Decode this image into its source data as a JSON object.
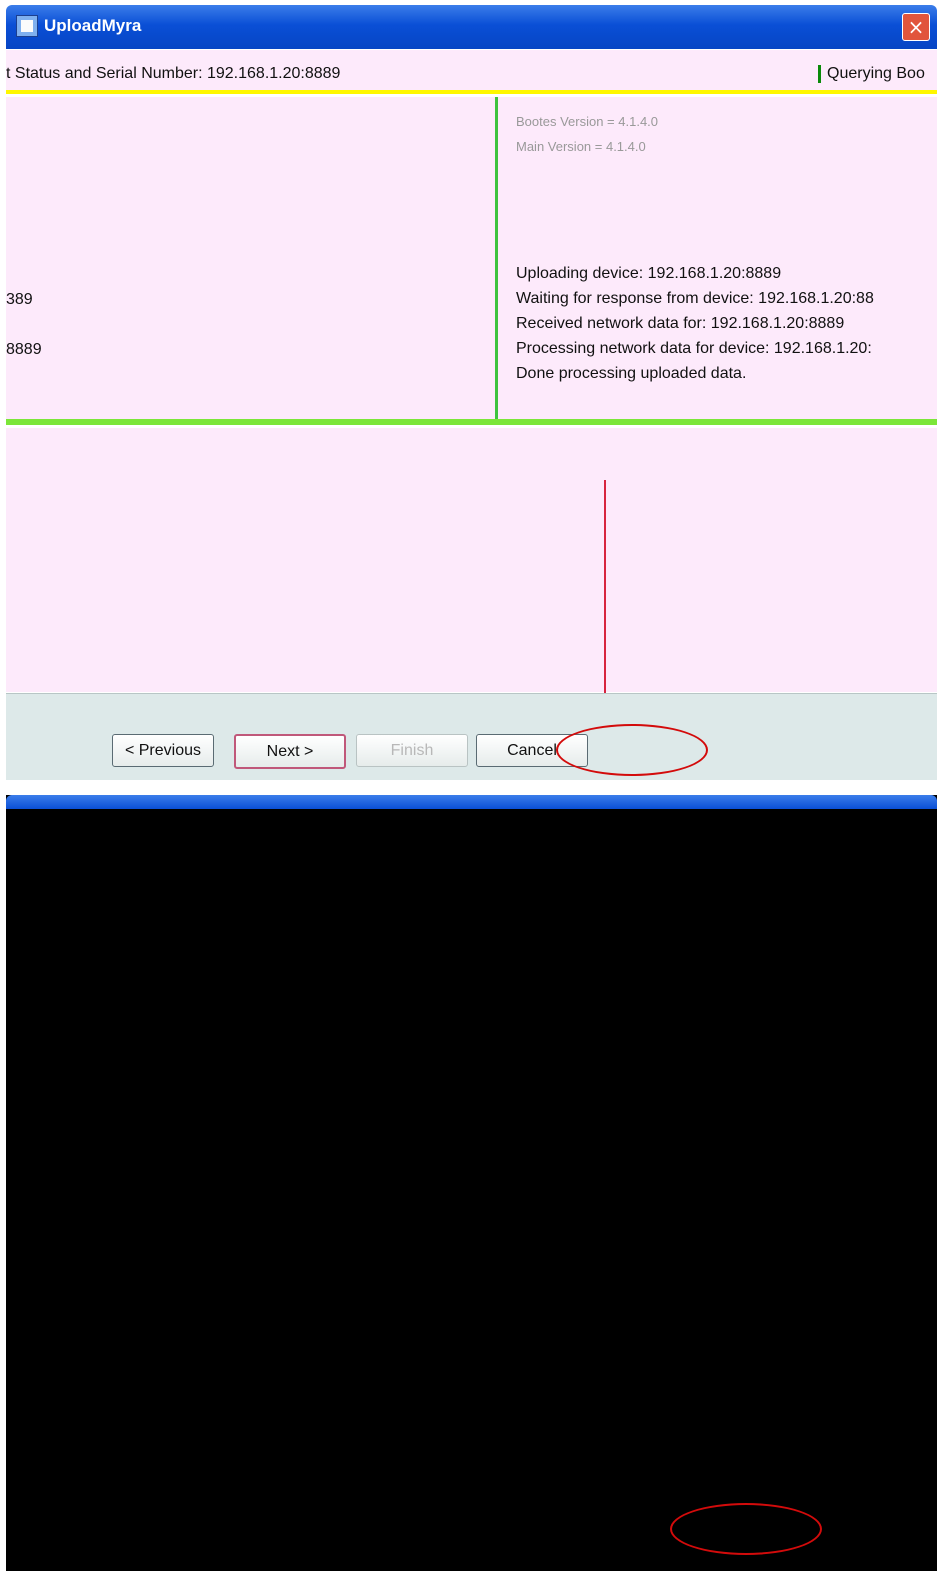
{
  "window": {
    "title": "UploadMyra",
    "close_icon": "close-icon",
    "app_icon": "app-icon"
  },
  "status_row": {
    "label": "t Status and Serial Number: 192.168.1.20:8889",
    "right_label": "Querying Boo"
  },
  "left_log": [
    {
      "text": "389"
    },
    {
      "text": "8889"
    }
  ],
  "right_log": {
    "faint_lines": [
      "Bootes Version = 4.1.4.0",
      "Main Version = 4.1.4.0"
    ],
    "lines": [
      "Uploading device: 192.168.1.20:8889",
      "Waiting for response from device: 192.168.1.20:88",
      "Received network data for: 192.168.1.20:8889",
      "Processing network data for device: 192.168.1.20:",
      "Done processing uploaded data."
    ]
  },
  "buttons": {
    "previous": "< Previous",
    "next": "Next >",
    "finish": "Finish",
    "cancel": "Cancel"
  },
  "colors": {
    "title_bar": "#0a4fd6",
    "pane_background": "#fdeafb",
    "button_bar": "#dde9e9",
    "highlight_circle": "#d30b0b"
  }
}
